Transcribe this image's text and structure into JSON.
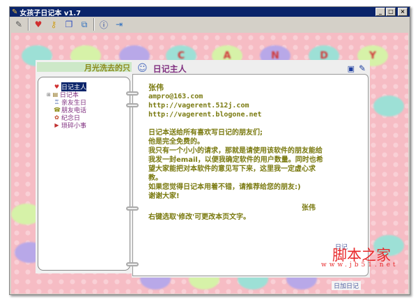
{
  "window": {
    "title": "女孩子日记本 v1.7",
    "controls": [
      "_",
      "□",
      "×"
    ]
  },
  "toolbar": {
    "icons": [
      "edit-icon",
      "heart-icon",
      "key-icon",
      "windows-icon",
      "copy-icon",
      "info-icon",
      "exit-icon"
    ]
  },
  "banner": {
    "letters": [
      "C",
      "A",
      "N",
      "D",
      "Y"
    ]
  },
  "left_panel": {
    "header": "月光洗去的只",
    "tree": [
      {
        "label": "日记主人",
        "icon": "heart-icon",
        "selected": true
      },
      {
        "label": "日记本",
        "icon": "book-icon",
        "expandable": true
      },
      {
        "label": "亲友生日",
        "icon": "cake-icon"
      },
      {
        "label": "朋友电话",
        "icon": "phone-icon"
      },
      {
        "label": "纪念日",
        "icon": "flower-icon"
      },
      {
        "label": "琐碎小事",
        "icon": "flag-icon"
      }
    ]
  },
  "right_panel": {
    "title": "日记主人",
    "name": "张伟",
    "email": "ampro@163.com",
    "url1": "http://vagerent.512j.com",
    "url2": "http://vagerent.blogone.net",
    "lines": [
      "日记本送给所有喜欢写日记的朋友们;",
      "他是完全免费的。",
      "我只有一个小小的请求，那就是请使用该软件的朋友能给",
      "我发一封email，以便我确定软件的用户数量。同时也希",
      "望大家能把对本软件的意见写下来，这里我一定虚心求",
      "教。",
      "如果您觉得日记本用着不错，请推荐给您的朋友:)",
      "谢谢大家!"
    ],
    "signature": "张伟",
    "hint": "右键选取'修改'可更改本页文字。"
  },
  "bottom": {
    "link1": "日记",
    "link2": "日加日记"
  },
  "watermark": {
    "text": "脚本之家",
    "url": "www.jb51.net"
  }
}
